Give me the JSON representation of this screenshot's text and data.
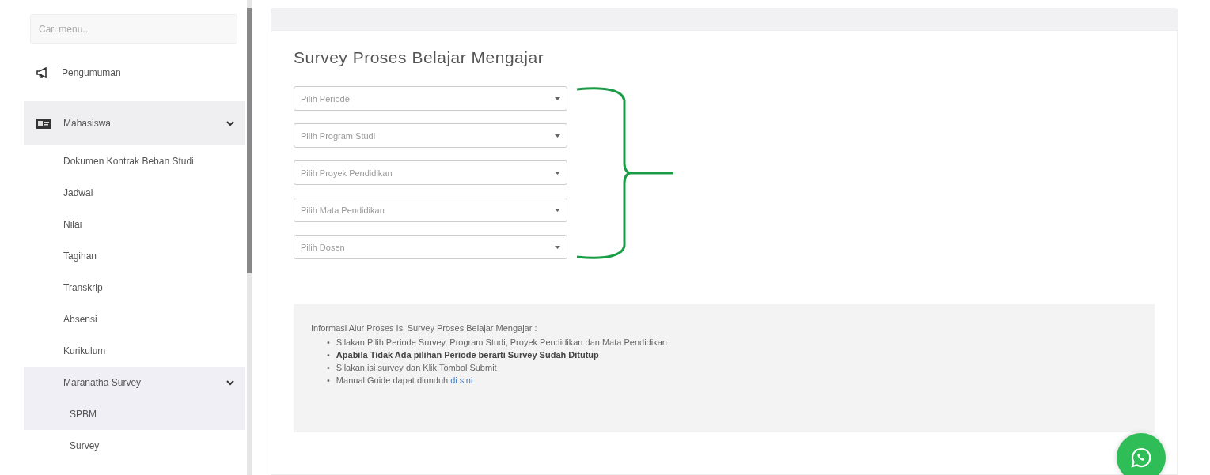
{
  "sidebar": {
    "search": {
      "placeholder": "Cari menu.."
    },
    "items": [
      {
        "label": "Pengumuman",
        "expanded": false
      },
      {
        "label": "Mahasiswa",
        "expanded": true,
        "children": [
          {
            "label": "Dokumen Kontrak Beban Studi"
          },
          {
            "label": "Jadwal"
          },
          {
            "label": "Nilai"
          },
          {
            "label": "Tagihan"
          },
          {
            "label": "Transkrip"
          },
          {
            "label": "Absensi"
          },
          {
            "label": "Kurikulum"
          },
          {
            "label": "Maranatha Survey",
            "expanded": true,
            "children": [
              {
                "label": "SPBM",
                "selected": true
              },
              {
                "label": "Survey",
                "selected": false
              }
            ]
          }
        ]
      }
    ]
  },
  "page": {
    "title": "Survey Proses Belajar Mengajar",
    "selects": [
      {
        "placeholder": "Pilih Periode"
      },
      {
        "placeholder": "Pilih Program Studi"
      },
      {
        "placeholder": "Pilih Proyek Pendidikan"
      },
      {
        "placeholder": "Pilih Mata Pendidikan"
      },
      {
        "placeholder": "Pilih Dosen"
      }
    ],
    "info": {
      "heading": "Informasi Alur Proses Isi Survey Proses Belajar Mengajar :",
      "items": [
        {
          "bullet": "•",
          "text": "Silakan Pilih Periode Survey, Program Studi, Proyek Pendidikan dan Mata Pendidikan",
          "emphasis": false
        },
        {
          "bullet": "•",
          "text": "Apabila Tidak Ada pilihan Periode berarti Survey Sudah Ditutup",
          "emphasis": true
        },
        {
          "bullet": "•",
          "text": "Silakan isi survey dan Klik Tombol Submit",
          "emphasis": false
        },
        {
          "bullet": "•",
          "text": "Manual Guide dapat diunduh",
          "link": "di sini",
          "emphasis": false
        }
      ]
    }
  }
}
